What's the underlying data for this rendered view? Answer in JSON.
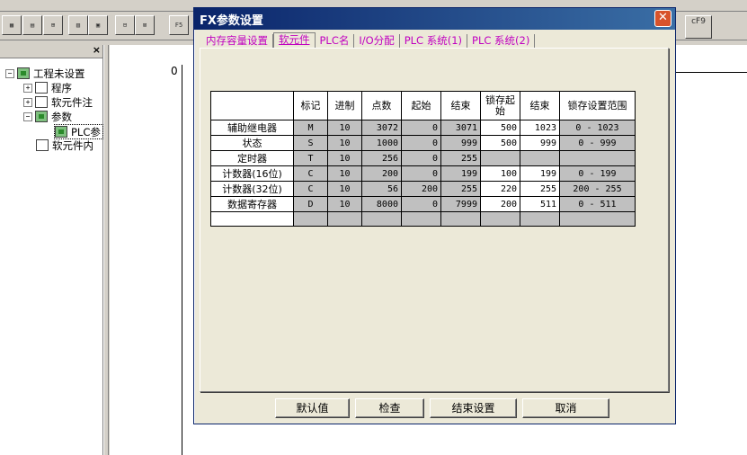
{
  "dialog": {
    "title": "FX参数设置",
    "close_label": "✕",
    "tabs": [
      {
        "label": "内存容量设置"
      },
      {
        "label": "软元件"
      },
      {
        "label": "PLC名"
      },
      {
        "label": "I/O分配"
      },
      {
        "label": "PLC 系统(1)"
      },
      {
        "label": "PLC 系统(2)"
      }
    ],
    "active_tab": 1,
    "grid": {
      "headers": [
        "",
        "标记",
        "进制",
        "点数",
        "起始",
        "结束",
        "锁存起始",
        "结束",
        "锁存设置范围"
      ],
      "rows": [
        [
          "辅助继电器",
          "M",
          "10",
          "3072",
          "0",
          "3071",
          "500",
          "1023",
          "0 - 1023"
        ],
        [
          "状态",
          "S",
          "10",
          "1000",
          "0",
          "999",
          "500",
          "999",
          "0 - 999"
        ],
        [
          "定时器",
          "T",
          "10",
          "256",
          "0",
          "255",
          "",
          "",
          ""
        ],
        [
          "计数器(16位)",
          "C",
          "10",
          "200",
          "0",
          "199",
          "100",
          "199",
          "0 - 199"
        ],
        [
          "计数器(32位)",
          "C",
          "10",
          "56",
          "200",
          "255",
          "220",
          "255",
          "200 - 255"
        ],
        [
          "数据寄存器",
          "D",
          "10",
          "8000",
          "0",
          "7999",
          "200",
          "511",
          "0 - 511"
        ],
        [
          "",
          "",
          "",
          "",
          "",
          "",
          "",
          "",
          ""
        ]
      ]
    },
    "buttons": {
      "default_label": "默认值",
      "check_label": "检查",
      "finish_label": "结束设置",
      "cancel_label": "取消"
    }
  },
  "tree": {
    "close_label": "×",
    "items": [
      {
        "label": "工程未设置"
      },
      {
        "label": "程序"
      },
      {
        "label": "软元件注"
      },
      {
        "label": "参数"
      },
      {
        "label": "PLC参"
      },
      {
        "label": "软元件内"
      }
    ]
  },
  "ladder": {
    "step_label": "0"
  },
  "toolbar": {
    "f5_label": "F5",
    "f9_label": "cF9"
  }
}
